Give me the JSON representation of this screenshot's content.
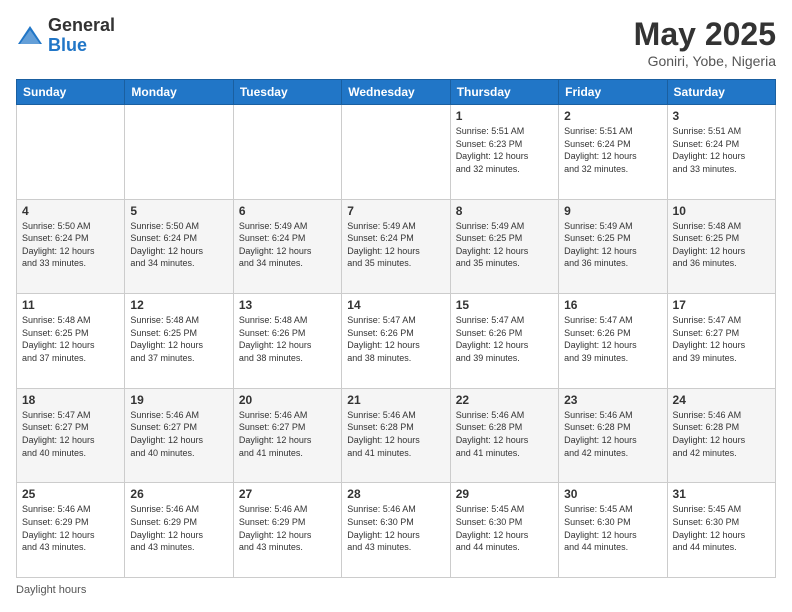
{
  "header": {
    "logo_general": "General",
    "logo_blue": "Blue",
    "month_title": "May 2025",
    "location": "Goniri, Yobe, Nigeria"
  },
  "weekdays": [
    "Sunday",
    "Monday",
    "Tuesday",
    "Wednesday",
    "Thursday",
    "Friday",
    "Saturday"
  ],
  "footer": {
    "label": "Daylight hours"
  },
  "weeks": [
    [
      {
        "day": "",
        "info": ""
      },
      {
        "day": "",
        "info": ""
      },
      {
        "day": "",
        "info": ""
      },
      {
        "day": "",
        "info": ""
      },
      {
        "day": "1",
        "info": "Sunrise: 5:51 AM\nSunset: 6:23 PM\nDaylight: 12 hours\nand 32 minutes."
      },
      {
        "day": "2",
        "info": "Sunrise: 5:51 AM\nSunset: 6:24 PM\nDaylight: 12 hours\nand 32 minutes."
      },
      {
        "day": "3",
        "info": "Sunrise: 5:51 AM\nSunset: 6:24 PM\nDaylight: 12 hours\nand 33 minutes."
      }
    ],
    [
      {
        "day": "4",
        "info": "Sunrise: 5:50 AM\nSunset: 6:24 PM\nDaylight: 12 hours\nand 33 minutes."
      },
      {
        "day": "5",
        "info": "Sunrise: 5:50 AM\nSunset: 6:24 PM\nDaylight: 12 hours\nand 34 minutes."
      },
      {
        "day": "6",
        "info": "Sunrise: 5:49 AM\nSunset: 6:24 PM\nDaylight: 12 hours\nand 34 minutes."
      },
      {
        "day": "7",
        "info": "Sunrise: 5:49 AM\nSunset: 6:24 PM\nDaylight: 12 hours\nand 35 minutes."
      },
      {
        "day": "8",
        "info": "Sunrise: 5:49 AM\nSunset: 6:25 PM\nDaylight: 12 hours\nand 35 minutes."
      },
      {
        "day": "9",
        "info": "Sunrise: 5:49 AM\nSunset: 6:25 PM\nDaylight: 12 hours\nand 36 minutes."
      },
      {
        "day": "10",
        "info": "Sunrise: 5:48 AM\nSunset: 6:25 PM\nDaylight: 12 hours\nand 36 minutes."
      }
    ],
    [
      {
        "day": "11",
        "info": "Sunrise: 5:48 AM\nSunset: 6:25 PM\nDaylight: 12 hours\nand 37 minutes."
      },
      {
        "day": "12",
        "info": "Sunrise: 5:48 AM\nSunset: 6:25 PM\nDaylight: 12 hours\nand 37 minutes."
      },
      {
        "day": "13",
        "info": "Sunrise: 5:48 AM\nSunset: 6:26 PM\nDaylight: 12 hours\nand 38 minutes."
      },
      {
        "day": "14",
        "info": "Sunrise: 5:47 AM\nSunset: 6:26 PM\nDaylight: 12 hours\nand 38 minutes."
      },
      {
        "day": "15",
        "info": "Sunrise: 5:47 AM\nSunset: 6:26 PM\nDaylight: 12 hours\nand 39 minutes."
      },
      {
        "day": "16",
        "info": "Sunrise: 5:47 AM\nSunset: 6:26 PM\nDaylight: 12 hours\nand 39 minutes."
      },
      {
        "day": "17",
        "info": "Sunrise: 5:47 AM\nSunset: 6:27 PM\nDaylight: 12 hours\nand 39 minutes."
      }
    ],
    [
      {
        "day": "18",
        "info": "Sunrise: 5:47 AM\nSunset: 6:27 PM\nDaylight: 12 hours\nand 40 minutes."
      },
      {
        "day": "19",
        "info": "Sunrise: 5:46 AM\nSunset: 6:27 PM\nDaylight: 12 hours\nand 40 minutes."
      },
      {
        "day": "20",
        "info": "Sunrise: 5:46 AM\nSunset: 6:27 PM\nDaylight: 12 hours\nand 41 minutes."
      },
      {
        "day": "21",
        "info": "Sunrise: 5:46 AM\nSunset: 6:28 PM\nDaylight: 12 hours\nand 41 minutes."
      },
      {
        "day": "22",
        "info": "Sunrise: 5:46 AM\nSunset: 6:28 PM\nDaylight: 12 hours\nand 41 minutes."
      },
      {
        "day": "23",
        "info": "Sunrise: 5:46 AM\nSunset: 6:28 PM\nDaylight: 12 hours\nand 42 minutes."
      },
      {
        "day": "24",
        "info": "Sunrise: 5:46 AM\nSunset: 6:28 PM\nDaylight: 12 hours\nand 42 minutes."
      }
    ],
    [
      {
        "day": "25",
        "info": "Sunrise: 5:46 AM\nSunset: 6:29 PM\nDaylight: 12 hours\nand 43 minutes."
      },
      {
        "day": "26",
        "info": "Sunrise: 5:46 AM\nSunset: 6:29 PM\nDaylight: 12 hours\nand 43 minutes."
      },
      {
        "day": "27",
        "info": "Sunrise: 5:46 AM\nSunset: 6:29 PM\nDaylight: 12 hours\nand 43 minutes."
      },
      {
        "day": "28",
        "info": "Sunrise: 5:46 AM\nSunset: 6:30 PM\nDaylight: 12 hours\nand 43 minutes."
      },
      {
        "day": "29",
        "info": "Sunrise: 5:45 AM\nSunset: 6:30 PM\nDaylight: 12 hours\nand 44 minutes."
      },
      {
        "day": "30",
        "info": "Sunrise: 5:45 AM\nSunset: 6:30 PM\nDaylight: 12 hours\nand 44 minutes."
      },
      {
        "day": "31",
        "info": "Sunrise: 5:45 AM\nSunset: 6:30 PM\nDaylight: 12 hours\nand 44 minutes."
      }
    ]
  ]
}
